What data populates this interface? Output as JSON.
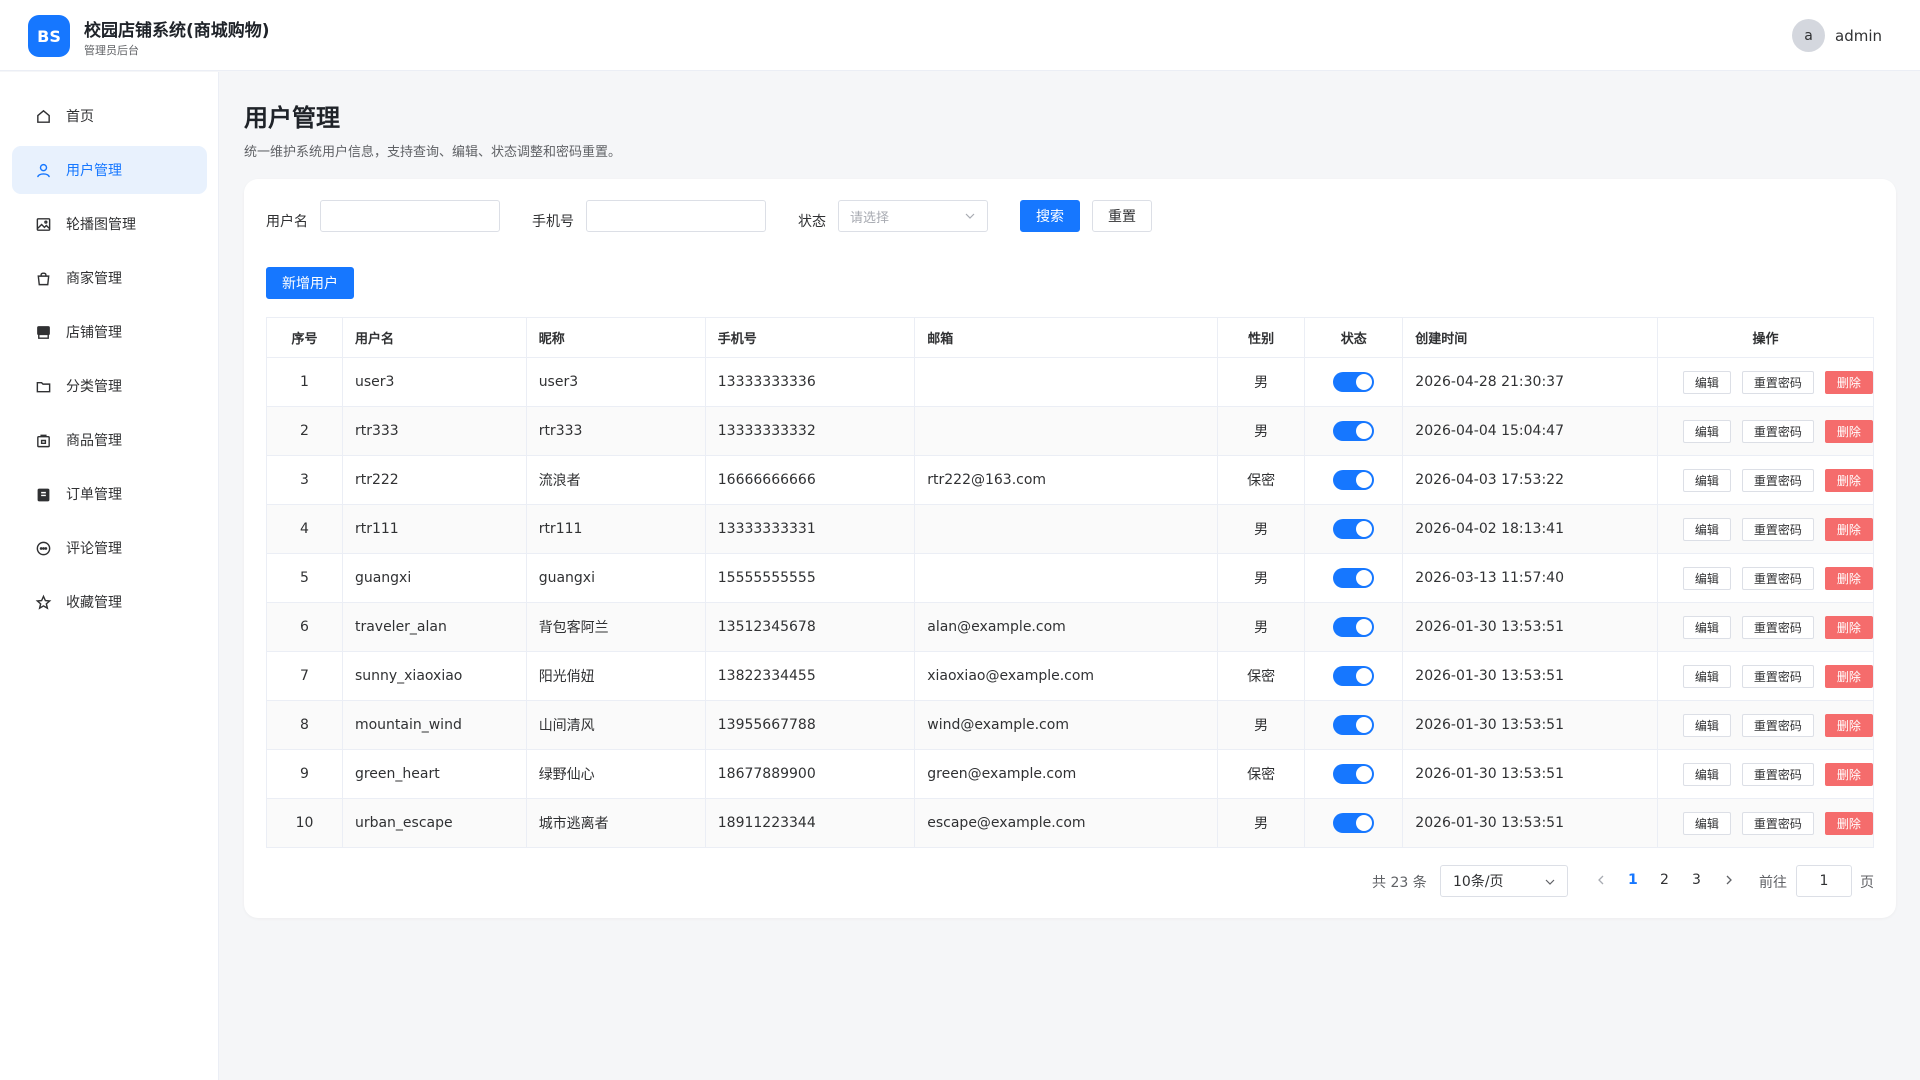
{
  "header": {
    "logo_text": "BS",
    "title": "校园店铺系统(商城购物)",
    "subtitle": "管理员后台",
    "user_avatar": "a",
    "user_name": "admin"
  },
  "sidebar": {
    "items": [
      {
        "label": "首页",
        "icon": "home-icon"
      },
      {
        "label": "用户管理",
        "icon": "user-icon",
        "active": true
      },
      {
        "label": "轮播图管理",
        "icon": "image-icon"
      },
      {
        "label": "商家管理",
        "icon": "bag-icon"
      },
      {
        "label": "店铺管理",
        "icon": "store-icon"
      },
      {
        "label": "分类管理",
        "icon": "folder-icon"
      },
      {
        "label": "商品管理",
        "icon": "goods-icon"
      },
      {
        "label": "订单管理",
        "icon": "clipboard-icon"
      },
      {
        "label": "评论管理",
        "icon": "comment-icon"
      },
      {
        "label": "收藏管理",
        "icon": "star-icon"
      }
    ]
  },
  "page": {
    "title": "用户管理",
    "description": "统一维护系统用户信息，支持查询、编辑、状态调整和密码重置。"
  },
  "search": {
    "username_label": "用户名",
    "username_value": "",
    "phone_label": "手机号",
    "phone_value": "",
    "status_label": "状态",
    "status_placeholder": "请选择",
    "search_button": "搜索",
    "reset_button": "重置"
  },
  "add_button": "新增用户",
  "table": {
    "columns": [
      "序号",
      "用户名",
      "昵称",
      "手机号",
      "邮箱",
      "性别",
      "状态",
      "创建时间",
      "操作"
    ],
    "actions": {
      "edit": "编辑",
      "reset_password": "重置密码",
      "delete": "删除"
    },
    "rows": [
      {
        "no": "1",
        "username": "user3",
        "nickname": "user3",
        "phone": "13333333336",
        "email": "",
        "gender": "男",
        "enabled": true,
        "created": "2026-04-28 21:30:37"
      },
      {
        "no": "2",
        "username": "rtr333",
        "nickname": "rtr333",
        "phone": "13333333332",
        "email": "",
        "gender": "男",
        "enabled": true,
        "created": "2026-04-04 15:04:47"
      },
      {
        "no": "3",
        "username": "rtr222",
        "nickname": "流浪者",
        "phone": "16666666666",
        "email": "rtr222@163.com",
        "gender": "保密",
        "enabled": true,
        "created": "2026-04-03 17:53:22"
      },
      {
        "no": "4",
        "username": "rtr111",
        "nickname": "rtr111",
        "phone": "13333333331",
        "email": "",
        "gender": "男",
        "enabled": true,
        "created": "2026-04-02 18:13:41"
      },
      {
        "no": "5",
        "username": "guangxi",
        "nickname": "guangxi",
        "phone": "15555555555",
        "email": "",
        "gender": "男",
        "enabled": true,
        "created": "2026-03-13 11:57:40"
      },
      {
        "no": "6",
        "username": "traveler_alan",
        "nickname": "背包客阿兰",
        "phone": "13512345678",
        "email": "alan@example.com",
        "gender": "男",
        "enabled": true,
        "created": "2026-01-30 13:53:51"
      },
      {
        "no": "7",
        "username": "sunny_xiaoxiao",
        "nickname": "阳光俏妞",
        "phone": "13822334455",
        "email": "xiaoxiao@example.com",
        "gender": "保密",
        "enabled": true,
        "created": "2026-01-30 13:53:51"
      },
      {
        "no": "8",
        "username": "mountain_wind",
        "nickname": "山间清风",
        "phone": "13955667788",
        "email": "wind@example.com",
        "gender": "男",
        "enabled": true,
        "created": "2026-01-30 13:53:51"
      },
      {
        "no": "9",
        "username": "green_heart",
        "nickname": "绿野仙心",
        "phone": "18677889900",
        "email": "green@example.com",
        "gender": "保密",
        "enabled": true,
        "created": "2026-01-30 13:53:51"
      },
      {
        "no": "10",
        "username": "urban_escape",
        "nickname": "城市逃离者",
        "phone": "18911223344",
        "email": "escape@example.com",
        "gender": "男",
        "enabled": true,
        "created": "2026-01-30 13:53:51"
      }
    ]
  },
  "pagination": {
    "total_text": "共 23 条",
    "page_size": "10条/页",
    "pages": [
      "1",
      "2",
      "3"
    ],
    "current_page": "1",
    "goto_label": "前往",
    "goto_value": "1",
    "page_unit": "页"
  },
  "colors": {
    "primary": "#1677ff",
    "danger": "#f56c6c",
    "active_nav_bg": "#e8f1fd"
  }
}
